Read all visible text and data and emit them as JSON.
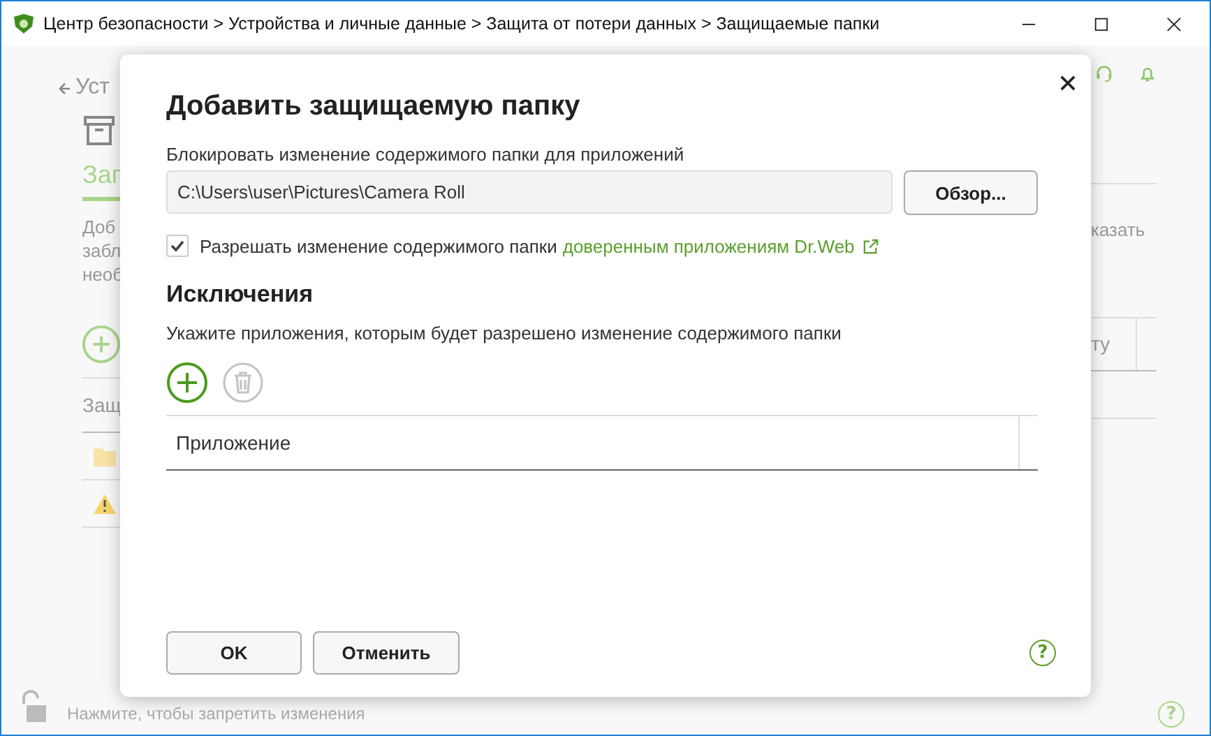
{
  "window": {
    "title": "Центр безопасности > Устройства и личные данные > Защита от потери данных > Защищаемые папки"
  },
  "background": {
    "back_link": "Уст",
    "help_button": "?",
    "tab": "Зап",
    "description_lines": [
      "Доб",
      "забл",
      "необ"
    ],
    "description_tail": "казать",
    "table_header": "Защ",
    "table_header_tail": "ту",
    "lock_hint": "Нажмите, чтобы запретить изменения"
  },
  "dialog": {
    "title": "Добавить защищаемую папку",
    "path_label": "Блокировать изменение содержимого папки для приложений",
    "path_value": "C:\\Users\\user\\Pictures\\Camera Roll",
    "browse_button": "Обзор...",
    "allow_trusted": {
      "checked": true,
      "text": "Разрешать изменение содержимого папки",
      "link": "доверенным приложениям Dr.Web"
    },
    "exceptions_title": "Исключения",
    "exceptions_hint": "Укажите приложения, которым будет разрешено изменение содержимого папки",
    "delete_disabled": true,
    "help_button": "?",
    "table": {
      "columns": [
        "Приложение"
      ]
    },
    "buttons": [
      "OK",
      "Отменить"
    ]
  }
}
